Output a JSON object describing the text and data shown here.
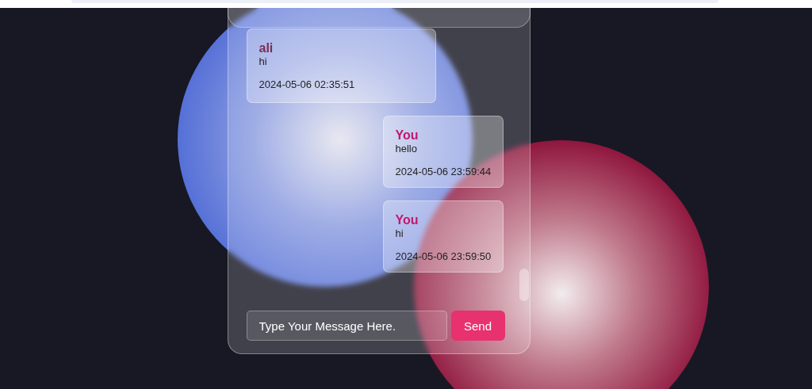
{
  "messages": [
    {
      "kind": "received",
      "sender": "ali",
      "text": "hi",
      "time": "2024-05-06 02:35:51"
    },
    {
      "kind": "sent",
      "sender": "You",
      "text": "hello",
      "time": "2024-05-06 23:59:44"
    },
    {
      "kind": "sent",
      "sender": "You",
      "text": "hi",
      "time": "2024-05-06 23:59:50"
    }
  ],
  "composer": {
    "placeholder": "Type Your Message Here.",
    "button": "Send"
  }
}
